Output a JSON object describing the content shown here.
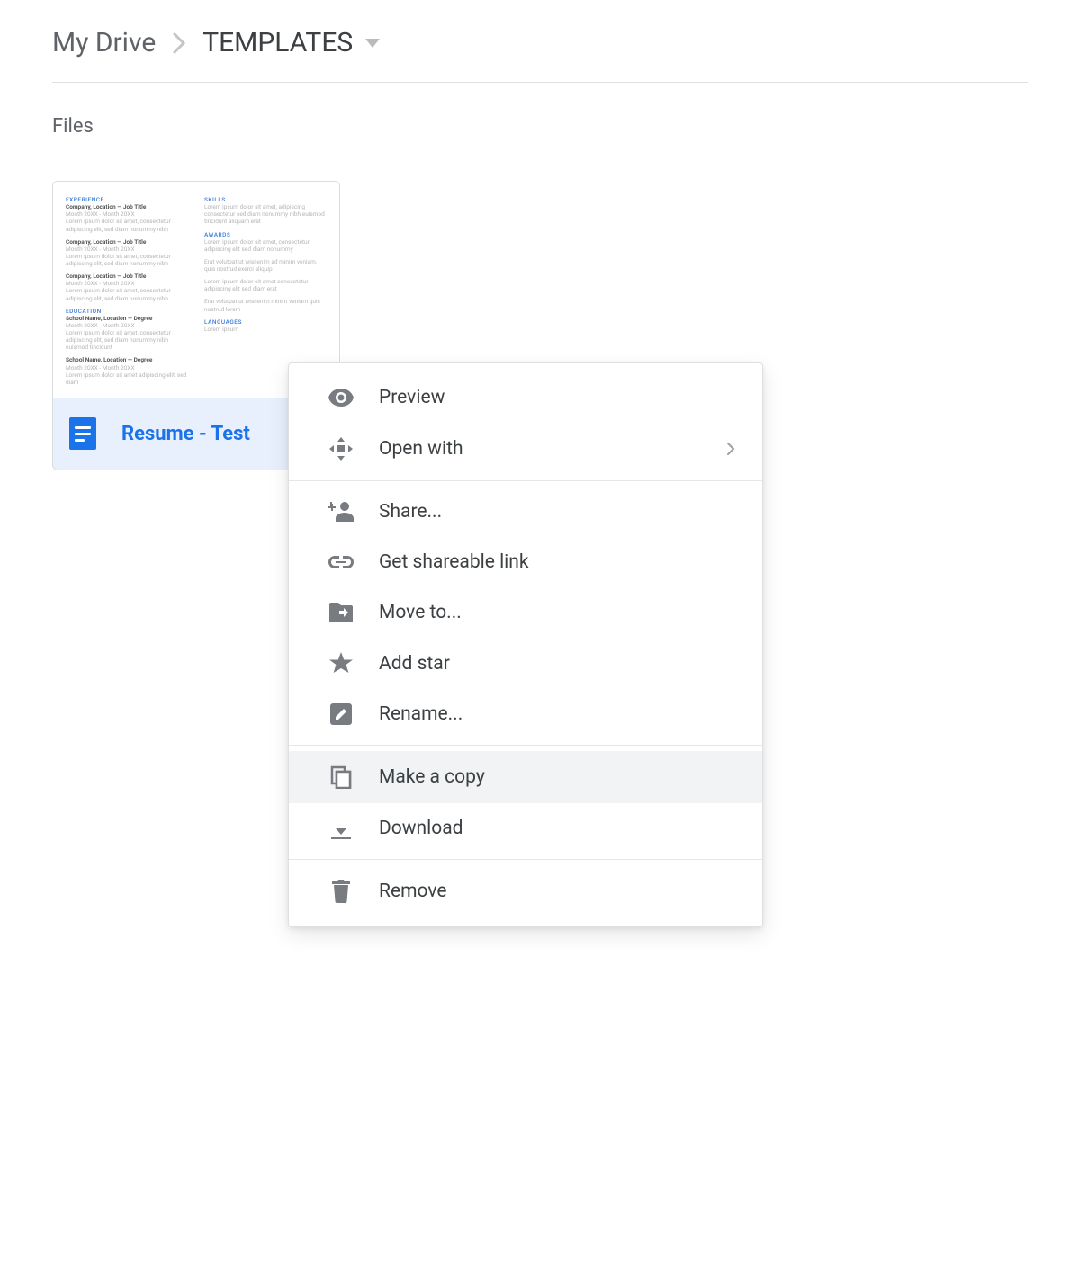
{
  "breadcrumb": {
    "root": "My Drive",
    "current": "TEMPLATES"
  },
  "section": {
    "heading": "Files"
  },
  "file": {
    "name": "Resume - Test"
  },
  "menu": {
    "preview": "Preview",
    "open_with": "Open with",
    "share": "Share...",
    "get_link": "Get shareable link",
    "move_to": "Move to...",
    "add_star": "Add star",
    "rename": "Rename...",
    "make_copy": "Make a copy",
    "download": "Download",
    "remove": "Remove"
  }
}
